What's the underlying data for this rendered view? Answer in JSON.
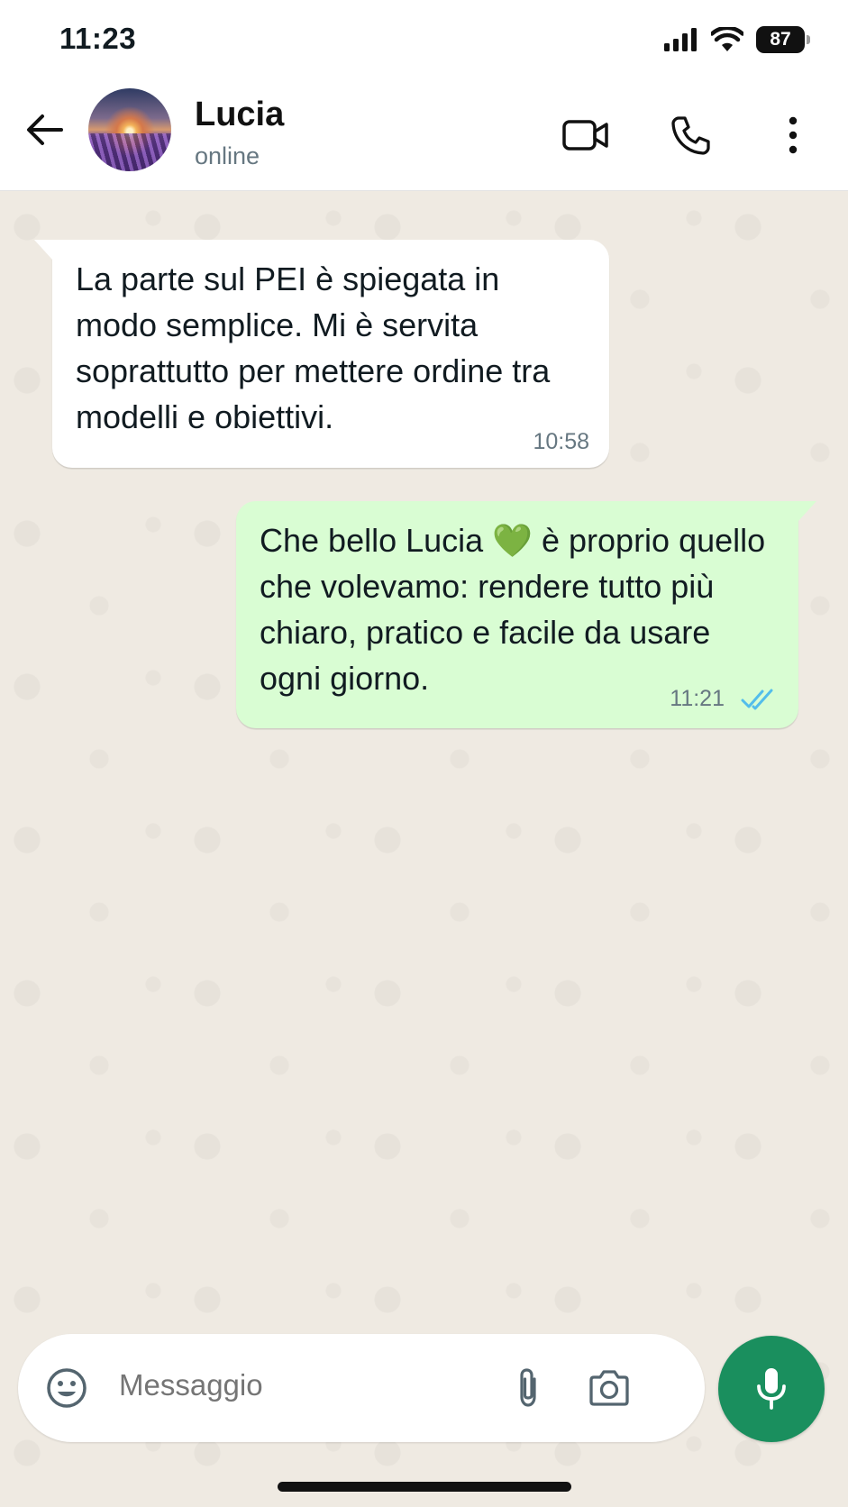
{
  "status_bar": {
    "time": "11:23",
    "battery": "87",
    "icons": [
      "signal-icon",
      "wifi-icon",
      "battery-icon"
    ]
  },
  "header": {
    "contact_name": "Lucia",
    "contact_status": "online",
    "icons": [
      "back-arrow-icon",
      "video-call-icon",
      "phone-icon",
      "more-vert-icon"
    ]
  },
  "messages": [
    {
      "direction": "incoming",
      "text": "La parte sul PEI è spiegata in modo semplice. Mi è servita soprattutto per mettere ordine tra modelli e obiettivi.",
      "time": "10:58"
    },
    {
      "direction": "outgoing",
      "text": "Che bello Lucia 💚 è proprio quello che volevamo: rendere tutto più chiaro, pratico e facile da usare ogni giorno.",
      "time": "11:21",
      "status": "read"
    }
  ],
  "composer": {
    "placeholder": "Messaggio",
    "icons": [
      "emoji-icon",
      "attach-icon",
      "camera-icon",
      "mic-icon"
    ]
  },
  "colors": {
    "outgoing_bubble": "#d9fdd3",
    "incoming_bubble": "#ffffff",
    "accent": "#1a8f5e",
    "read_ticks": "#53bdeb",
    "chat_bg": "#efeae2"
  }
}
